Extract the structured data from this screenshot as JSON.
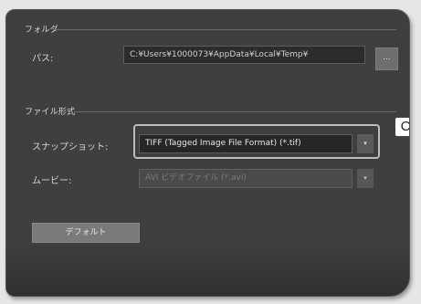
{
  "folder_section": {
    "title": "フォルダ",
    "path_label": "パス:",
    "path_value": "C:¥Users¥1000073¥AppData¥Local¥Temp¥",
    "browse_label": "..."
  },
  "format_section": {
    "title": "ファイル形式",
    "snapshot_label": "スナップショット:",
    "snapshot_value": "TIFF (Tagged Image File Format) (*.tif)",
    "movie_label": "ムービー:",
    "movie_value": "AVI ビデオファイル (*.avi)",
    "dropdown_arrow": "▾"
  },
  "callout_label": "C",
  "default_button_label": "デフォルト",
  "colors": {
    "panel_bg": "#3f3f3f",
    "highlight": "#bdbdbd"
  }
}
